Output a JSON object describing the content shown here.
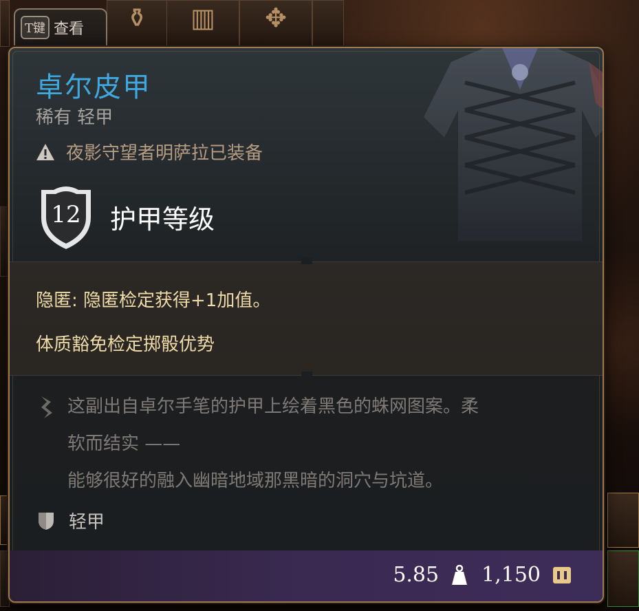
{
  "keybind_hint": {
    "key": "T键",
    "label": "查看"
  },
  "item": {
    "name": "卓尔皮甲",
    "rarity_type": "稀有 轻甲",
    "equipped_note": "夜影守望者明萨拉已装备",
    "armor_class_value": "12",
    "armor_class_label": "护甲等级",
    "effects": [
      "隐匿: 隐匿检定获得+1加值。",
      "体质豁免检定掷骰优势"
    ],
    "flavor_lines": [
      "这副出自卓尔手笔的护甲上绘着黑色的蛛网图案。柔",
      "软而结实 ——",
      "能够很好的融入幽暗地域那黑暗的洞穴与坑道。"
    ],
    "proficiency": "轻甲",
    "weight": "5.85",
    "price": "1,150"
  },
  "colors": {
    "title": "#3fa8df",
    "effect": "#efdca8",
    "flavor": "#7f7a75",
    "panel_border": "#9c7a52",
    "footer": "#3a2a52"
  },
  "icons": {
    "warning": "warning-icon",
    "shield": "shield-icon",
    "quill": "quill-icon",
    "light_armor": "light-armor-icon",
    "weight": "weight-icon",
    "gold": "gold-coin-icon"
  }
}
